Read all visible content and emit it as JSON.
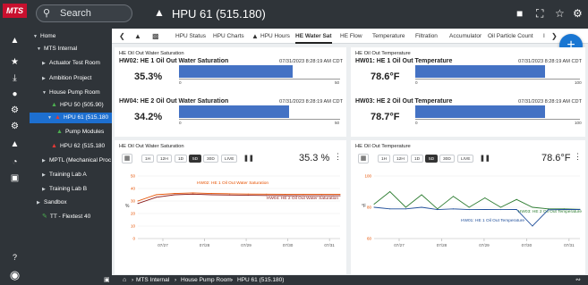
{
  "app": {
    "logo_text": "MTS",
    "search_placeholder": "Search",
    "title": "HPU 61 (515.180)"
  },
  "colors": {
    "rail": "#2f3439",
    "accent": "#1d6fd0",
    "bar": "#4472c4",
    "fab": "#1976d2",
    "hw01": "#2e7d32",
    "hw02": "#e65100",
    "hw04": "#8b1a1a"
  },
  "tree": [
    {
      "label": "Home",
      "caret": "▼",
      "icon": "",
      "selected": false
    },
    {
      "label": "MTS Internal",
      "caret": "▼",
      "icon": "",
      "selected": false
    },
    {
      "label": "Actuator Test Room",
      "caret": "▶",
      "icon": "",
      "selected": false
    },
    {
      "label": "Ambition Project",
      "caret": "▶",
      "icon": "",
      "selected": false
    },
    {
      "label": "House Pump Room",
      "caret": "▼",
      "icon": "",
      "selected": false
    },
    {
      "label": "HPU 50 (505.90)",
      "caret": "",
      "icon": "hpu-icon-green",
      "selected": false
    },
    {
      "label": "HPU 61 (515.180",
      "caret": "▼",
      "icon": "hpu-icon-red",
      "selected": true
    },
    {
      "label": "Pump Modules",
      "caret": "",
      "icon": "hpu-icon-green",
      "selected": false
    },
    {
      "label": "HPU 62 (515.180",
      "caret": "",
      "icon": "hpu-icon-red",
      "selected": false
    },
    {
      "label": "MPTL (Mechanical Proc",
      "caret": "▶",
      "icon": "",
      "selected": false
    },
    {
      "label": "Training Lab A",
      "caret": "▶",
      "icon": "",
      "selected": false
    },
    {
      "label": "Training Lab B",
      "caret": "▶",
      "icon": "",
      "selected": false
    },
    {
      "label": "Sandbox",
      "caret": "▶",
      "icon": "",
      "selected": false
    },
    {
      "label": "TT - Flextest 40",
      "caret": "",
      "icon": "sensor-icon-green",
      "selected": false
    }
  ],
  "tabs": [
    "HPU Status",
    "HPU Charts",
    "HPU Hours",
    "HE Water Sat",
    "HE Flow",
    "Temperature",
    "Filtration",
    "Accumulator",
    "Oil Particle Count",
    "I"
  ],
  "active_tab": "HE Water Sat",
  "footer": {
    "breadcrumb": [
      "MTS Internal",
      "House Pump Room",
      "HPU 61 (515.180)"
    ]
  },
  "panels": {
    "water_sat": {
      "title": "HE Oil Out Water Saturation",
      "gauges": [
        {
          "name": "HW02: HE 1 Oil Out Water Saturation",
          "time": "07/31/2023 8:28:19 AM CDT",
          "value_text": "35.3%",
          "value": 35.3,
          "max": 50,
          "tick_min": "0",
          "tick_max": "50"
        },
        {
          "name": "HW04: HE 2 Oil Out Water Saturation",
          "time": "07/31/2023 8:28:19 AM CDT",
          "value_text": "34.2%",
          "value": 34.2,
          "max": 50,
          "tick_min": "0",
          "tick_max": "50"
        }
      ]
    },
    "temperature": {
      "title": "HE Oil Out Temperature",
      "gauges": [
        {
          "name": "HW01: HE 1 Oil Out Temperature",
          "time": "07/31/2023 8:28:19 AM CDT",
          "value_text": "78.6°F",
          "value": 78.6,
          "max": 100,
          "tick_min": "0",
          "tick_max": "100"
        },
        {
          "name": "HW03: HE 2 Oil Out Temperature",
          "time": "07/31/2023 8:28:19 AM CDT",
          "value_text": "78.7°F",
          "value": 78.7,
          "max": 100,
          "tick_min": "0",
          "tick_max": "100"
        }
      ]
    },
    "chart_left": {
      "title": "HE Oil Out Water Saturation",
      "ranges": [
        "1H",
        "12H",
        "1D",
        "5D",
        "30D",
        "LIVE"
      ],
      "selected_range": "5D",
      "current": "35.3 %"
    },
    "chart_right": {
      "title": "HE Oil Out Temperature",
      "ranges": [
        "1H",
        "12H",
        "1D",
        "5D",
        "30D",
        "LIVE"
      ],
      "selected_range": "5D",
      "current": "78.6°F"
    }
  },
  "chart_data": [
    {
      "type": "line",
      "title": "HE Oil Out Water Saturation",
      "ylabel": "%",
      "ylim": [
        0,
        50
      ],
      "yticks": [
        "50",
        "40",
        "30",
        "20",
        "10",
        "0"
      ],
      "xticks": [
        "07/27",
        "07/28",
        "07/29",
        "07/30",
        "07/31"
      ],
      "x": [
        "07/26 12:00",
        "07/26 18:00",
        "07/27",
        "07/27 12:00",
        "07/28",
        "07/28 12:00",
        "07/29",
        "07/29 12:00",
        "07/30",
        "07/30 12:00",
        "07/31",
        "07/31 08:28"
      ],
      "series": [
        {
          "name": "HW02: HE 1 Oil Out Water Saturation",
          "color": "#e65100",
          "values": [
            30,
            35,
            36,
            36.5,
            36,
            35.8,
            35.6,
            35.5,
            35.4,
            35.4,
            35.3,
            35.3
          ]
        },
        {
          "name": "HW04: HE 2 Oil Out Water Saturation",
          "color": "#8b1a1a",
          "values": [
            28,
            33,
            35,
            35.5,
            35,
            34.8,
            34.6,
            34.4,
            34.3,
            34.2,
            34.2,
            34.2
          ]
        }
      ]
    },
    {
      "type": "line",
      "title": "HE Oil Out Temperature",
      "ylabel": "°F",
      "ylim": [
        60,
        100
      ],
      "yticks": [
        "100",
        "80",
        "60"
      ],
      "xticks": [
        "07/27",
        "07/28",
        "07/29",
        "07/30",
        "07/31"
      ],
      "x": [
        "07/26 12:00",
        "07/26 18:00",
        "07/27",
        "07/27 06:00",
        "07/27 12:00",
        "07/28",
        "07/28 12:00",
        "07/29",
        "07/29 12:00",
        "07/30",
        "07/30 06:00",
        "07/30 12:00",
        "07/31",
        "07/31 08:28"
      ],
      "series": [
        {
          "name": "HW03: HE 2 Oil Out Temperature",
          "color": "#2e7d32",
          "values": [
            82,
            90,
            80,
            88,
            79,
            87,
            80,
            86,
            80,
            85,
            80,
            79,
            79,
            78.7
          ]
        },
        {
          "name": "HW01: HE 1 Oil Out Temperature",
          "color": "#1f4e9a",
          "values": [
            80,
            79,
            79,
            80,
            78.5,
            79,
            78.5,
            78.6,
            78.5,
            78.6,
            68,
            78.4,
            78.6,
            78.6
          ]
        }
      ]
    }
  ]
}
